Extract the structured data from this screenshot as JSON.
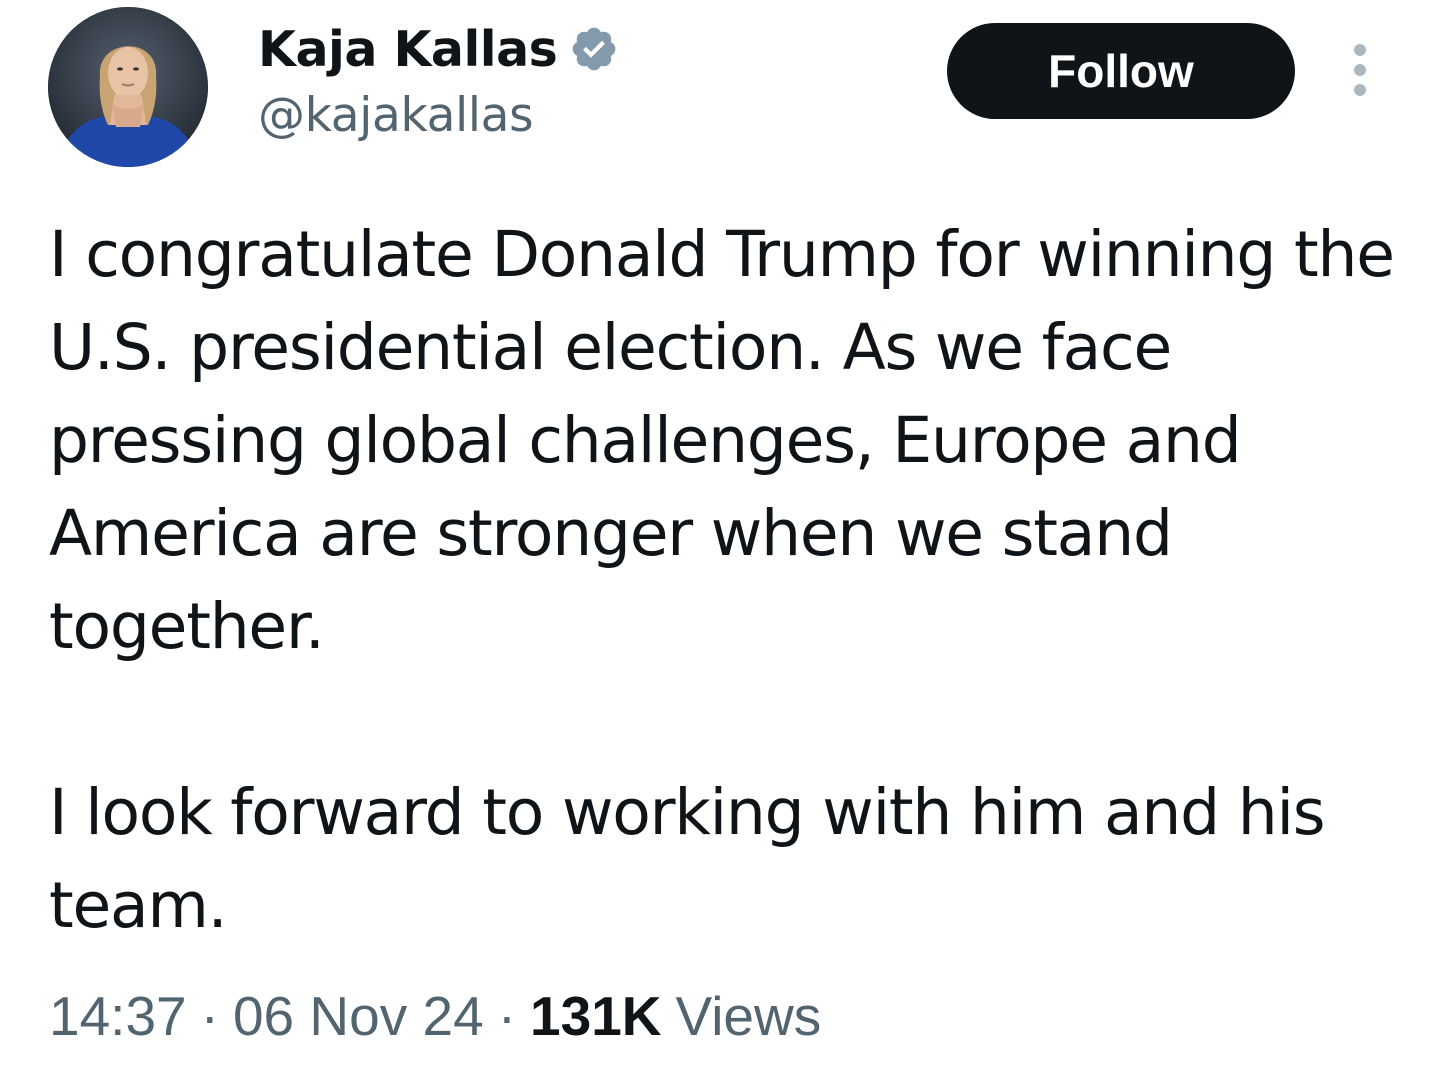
{
  "author": {
    "display_name": "Kaja Kallas",
    "handle": "@kajakallas",
    "verified": true,
    "verified_badge_color": "#829aab",
    "avatar_icon": "profile-photo"
  },
  "actions": {
    "follow_label": "Follow",
    "more_icon": "more-vertical-icon"
  },
  "tweet": {
    "paragraphs": [
      "I congratulate Donald Trump for winning the U.S. presidential election. As we face pressing global challenges, Europe and America are stronger when we stand together.",
      "I look forward to working with him and his team."
    ]
  },
  "meta": {
    "time": "14:37",
    "separator": "·",
    "date": "06 Nov 24",
    "views_count": "131K",
    "views_label": "Views"
  },
  "colors": {
    "text_primary": "#0f1419",
    "text_secondary": "#536471",
    "button_bg": "#0f1419",
    "button_text": "#ffffff",
    "more_dots": "#aab8c2"
  }
}
